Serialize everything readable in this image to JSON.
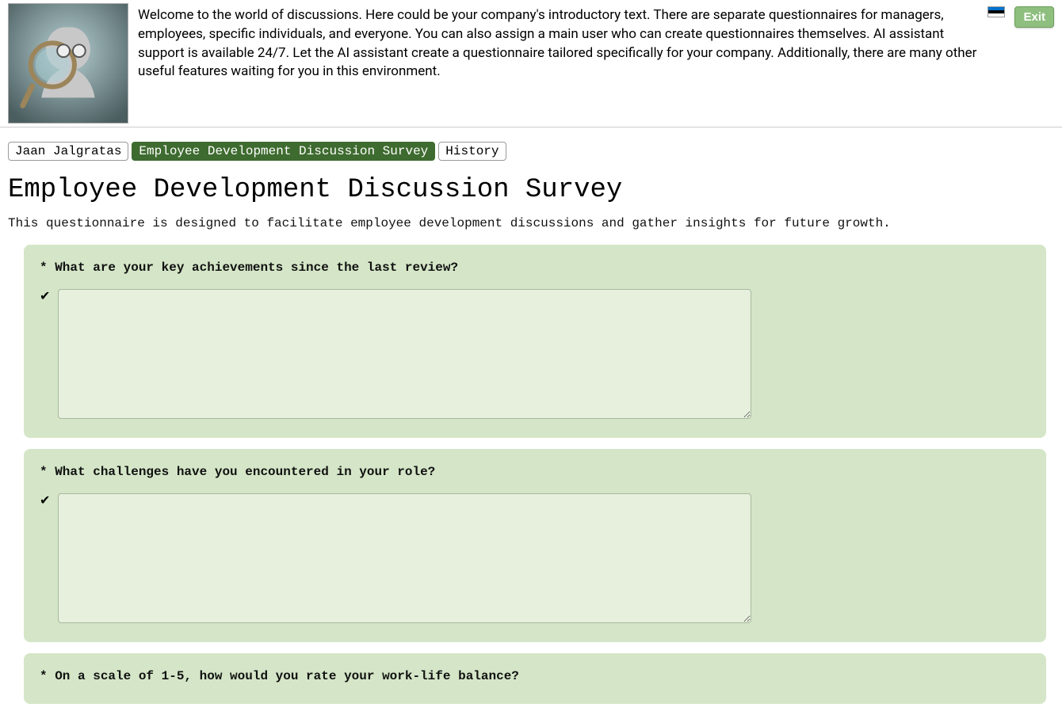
{
  "header": {
    "intro": "Welcome to the world of discussions. Here could be your company's introductory text. There are separate questionnaires for managers, employees, specific individuals, and everyone. You can also assign a main user who can create questionnaires themselves. AI assistant support is available 24/7. Let the AI assistant create a questionnaire tailored specifically for your company. Additionally, there are many other useful features waiting for you in this environment.",
    "exit_label": "Exit"
  },
  "tabs": {
    "items": [
      {
        "label": "Jaan Jalgratas",
        "active": false
      },
      {
        "label": "Employee Development Discussion Survey",
        "active": true
      },
      {
        "label": "History",
        "active": false
      }
    ]
  },
  "page": {
    "title": "Employee Development Discussion Survey",
    "description": "This questionnaire is designed to facilitate employee development discussions and gather insights for future growth."
  },
  "questions": [
    {
      "required_prefix": "* ",
      "text": "What are your key achievements since the last review?",
      "check": "✔",
      "value": ""
    },
    {
      "required_prefix": "* ",
      "text": "What challenges have you encountered in your role?",
      "check": "✔",
      "value": ""
    },
    {
      "required_prefix": "* ",
      "text": "On a scale of 1-5, how would you rate your work-life balance?",
      "check": "",
      "value": ""
    }
  ]
}
